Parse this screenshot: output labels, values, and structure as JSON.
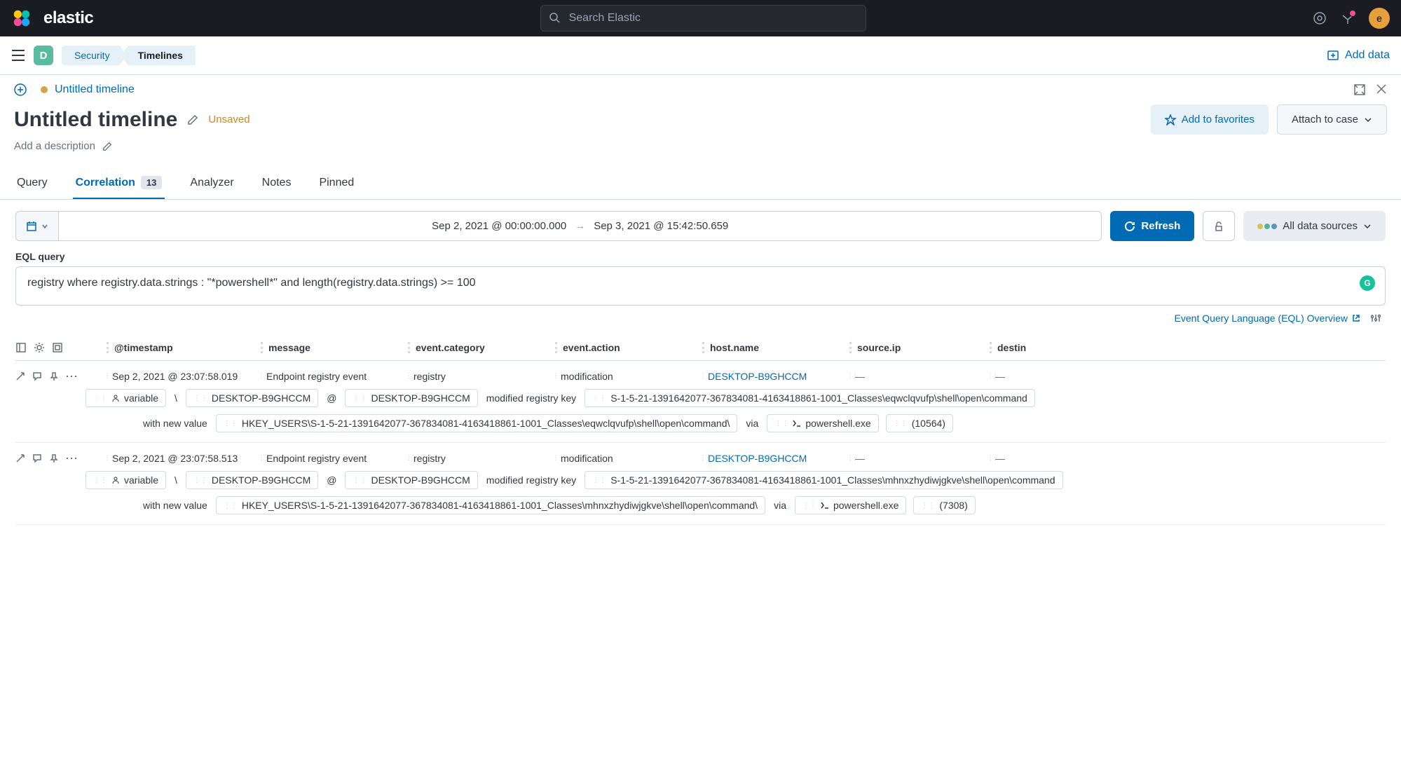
{
  "header": {
    "brand": "elastic",
    "search_placeholder": "Search Elastic",
    "avatar_letter": "e"
  },
  "subheader": {
    "space_letter": "D",
    "breadcrumbs": [
      "Security",
      "Timelines"
    ],
    "add_data": "Add data"
  },
  "timeline_tab": {
    "label": "Untitled timeline"
  },
  "title": {
    "text": "Untitled timeline",
    "status": "Unsaved",
    "description_placeholder": "Add a description",
    "favorites": "Add to favorites",
    "attach": "Attach to case"
  },
  "tabs": {
    "query": "Query",
    "correlation": "Correlation",
    "correlation_count": "13",
    "analyzer": "Analyzer",
    "notes": "Notes",
    "pinned": "Pinned"
  },
  "query_bar": {
    "date_from": "Sep 2, 2021 @ 00:00:00.000",
    "date_to": "Sep 3, 2021 @ 15:42:50.659",
    "refresh": "Refresh",
    "sources": "All data sources",
    "eql_label": "EQL query",
    "eql_query": "registry where  registry.data.strings : \"*powershell*\" and length(registry.data.strings) >= 100",
    "eql_link": "Event Query Language (EQL) Overview"
  },
  "columns": {
    "timestamp": "@timestamp",
    "message": "message",
    "category": "event.category",
    "action": "event.action",
    "host": "host.name",
    "source": "source.ip",
    "dest": "destin"
  },
  "rows": [
    {
      "timestamp": "Sep 2, 2021 @ 23:07:58.019",
      "message": "Endpoint registry event",
      "category": "registry",
      "action": "modification",
      "host": "DESKTOP-B9GHCCM",
      "source": "—",
      "dest": "—",
      "detail": {
        "variable": "variable",
        "host1": "DESKTOP-B9GHCCM",
        "host2": "DESKTOP-B9GHCCM",
        "mod_label": "modified registry key",
        "regkey": "S-1-5-21-1391642077-367834081-4163418861-1001_Classes\\eqwclqvufp\\shell\\open\\command",
        "new_val_label": "with new value",
        "regpath": "HKEY_USERS\\S-1-5-21-1391642077-367834081-4163418861-1001_Classes\\eqwclqvufp\\shell\\open\\command\\",
        "via": "via",
        "process": "powershell.exe",
        "pid": "(10564)"
      }
    },
    {
      "timestamp": "Sep 2, 2021 @ 23:07:58.513",
      "message": "Endpoint registry event",
      "category": "registry",
      "action": "modification",
      "host": "DESKTOP-B9GHCCM",
      "source": "—",
      "dest": "—",
      "detail": {
        "variable": "variable",
        "host1": "DESKTOP-B9GHCCM",
        "host2": "DESKTOP-B9GHCCM",
        "mod_label": "modified registry key",
        "regkey": "S-1-5-21-1391642077-367834081-4163418861-1001_Classes\\mhnxzhydiwjgkve\\shell\\open\\command",
        "new_val_label": "with new value",
        "regpath": "HKEY_USERS\\S-1-5-21-1391642077-367834081-4163418861-1001_Classes\\mhnxzhydiwjgkve\\shell\\open\\command\\",
        "via": "via",
        "process": "powershell.exe",
        "pid": "(7308)"
      }
    }
  ]
}
